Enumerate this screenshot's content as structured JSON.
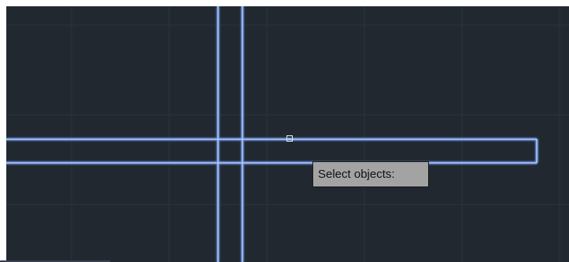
{
  "app": {
    "kind": "CAD drawing canvas"
  },
  "colors": {
    "canvas_bg": "#212830",
    "grid_line": "#2b3340",
    "selected_geometry": "#4f7fd9",
    "selected_highlight": "#dfe9ff",
    "tooltip_bg": "#a3a3a3"
  },
  "tooltip": {
    "prompt_text": "Select objects:"
  },
  "cursor": {
    "icon": "pickbox-icon"
  }
}
